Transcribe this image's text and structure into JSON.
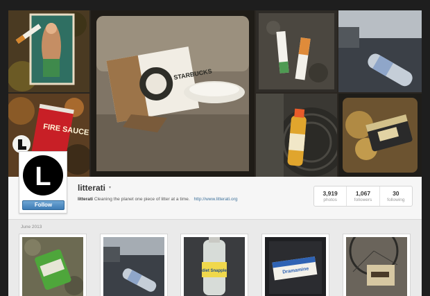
{
  "profile": {
    "username": "litterati",
    "caret": "▾",
    "follow_label": "Follow",
    "bio_name": "litterati",
    "bio_text": "Cleaning the planet one piece of litter at a time.",
    "bio_link": "http://www.litterati.org",
    "avatar_letter": "L"
  },
  "stats": [
    {
      "value": "3,919",
      "label": "photos"
    },
    {
      "value": "1,067",
      "label": "followers"
    },
    {
      "value": "30",
      "label": "following"
    }
  ],
  "feed": {
    "month_label": "June 2013"
  },
  "mosaic_text": {
    "fire_sauce": "FIRE SAUCE",
    "starbucks_cup": "STARBUCKS"
  },
  "thumb_text": {
    "snapple": "diet Snapple",
    "dramamine": "Dramamine"
  },
  "colors": {
    "link": "#3f729b",
    "follow_button": "#4a87bf",
    "page_bg": "#1e1e1e",
    "feed_bg": "#eaeaea"
  }
}
